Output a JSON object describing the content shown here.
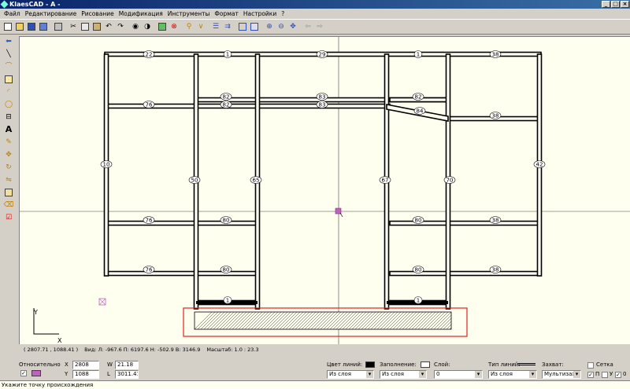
{
  "window": {
    "title": "KlaesCAD - A -",
    "controls": [
      "_",
      "□",
      "×"
    ]
  },
  "menu": [
    "Файл",
    "Редактирование",
    "Рисование",
    "Модификация",
    "Инструменты",
    "Формат",
    "Настройки",
    "?"
  ],
  "toolbar_icons": [
    "new-icon",
    "open-icon",
    "save-icon",
    "save-all-icon",
    "print-icon",
    "cut-icon",
    "copy-icon",
    "paste-icon",
    "undo-icon",
    "redo-icon",
    "eye-icon",
    "layers-icon",
    "refresh-icon",
    "stop-icon",
    "snap-icon",
    "hatch-icon",
    "align-icon",
    "distribute-icon",
    "zoom-window-icon",
    "zoom-extents-icon",
    "zoom-in-icon",
    "zoom-out-icon",
    "pan-icon",
    "arrow-left-icon",
    "arrow-right-icon"
  ],
  "left_tools": [
    "pointer-icon",
    "line-icon",
    "polyline-icon",
    "rectangle-icon",
    "arc-icon",
    "circle-icon",
    "dimension-icon",
    "text-icon",
    "edit-icon",
    "move-icon",
    "rotate-icon",
    "mirror-icon",
    "copy-obj-icon",
    "delete-icon",
    "properties-icon"
  ],
  "drawing": {
    "labels": [
      "22",
      "1",
      "29",
      "1",
      "38",
      "82",
      "83",
      "82",
      "76",
      "82",
      "83",
      "84",
      "38",
      "10",
      "50",
      "65",
      "67",
      "70",
      "42",
      "76",
      "80",
      "80",
      "38",
      "76",
      "80",
      "80",
      "38",
      "1",
      "1"
    ],
    "axis_labels": {
      "x": "X",
      "y": "Y"
    }
  },
  "status": {
    "coords": "( 2807.71 , 1088.41 )",
    "view": "Вид: Л: -967.6  П: 6197.6  Н: -502.9  В: 3146.9",
    "scale": "Масштаб: 1.0 : 23.3"
  },
  "panel": {
    "relative_label": "Относительно",
    "x_label": "X",
    "x_value": "2808",
    "y_label": "Y",
    "y_value": "1088",
    "w_label": "W",
    "w_value": "21.18",
    "l_label": "L",
    "l_value": "3011.41",
    "line_color_label": "Цвет линий:",
    "line_color_value": "Из слоя",
    "fill_label": "Заполнение:",
    "fill_value": "Из слоя",
    "layer_label": "Слой:",
    "layer_value": "0",
    "line_type_label": "Тип линий:",
    "line_type_value": "Из слоя",
    "capture_label": "Захват:",
    "capture_value": "Мультизахв",
    "grid_label": "Сетка",
    "flags": [
      "П",
      "У",
      "0"
    ]
  },
  "hint": "Укажите точку происхождения",
  "colors": {
    "canvas": "#fffff0",
    "selection": "#e02020",
    "frame": "#000000"
  }
}
